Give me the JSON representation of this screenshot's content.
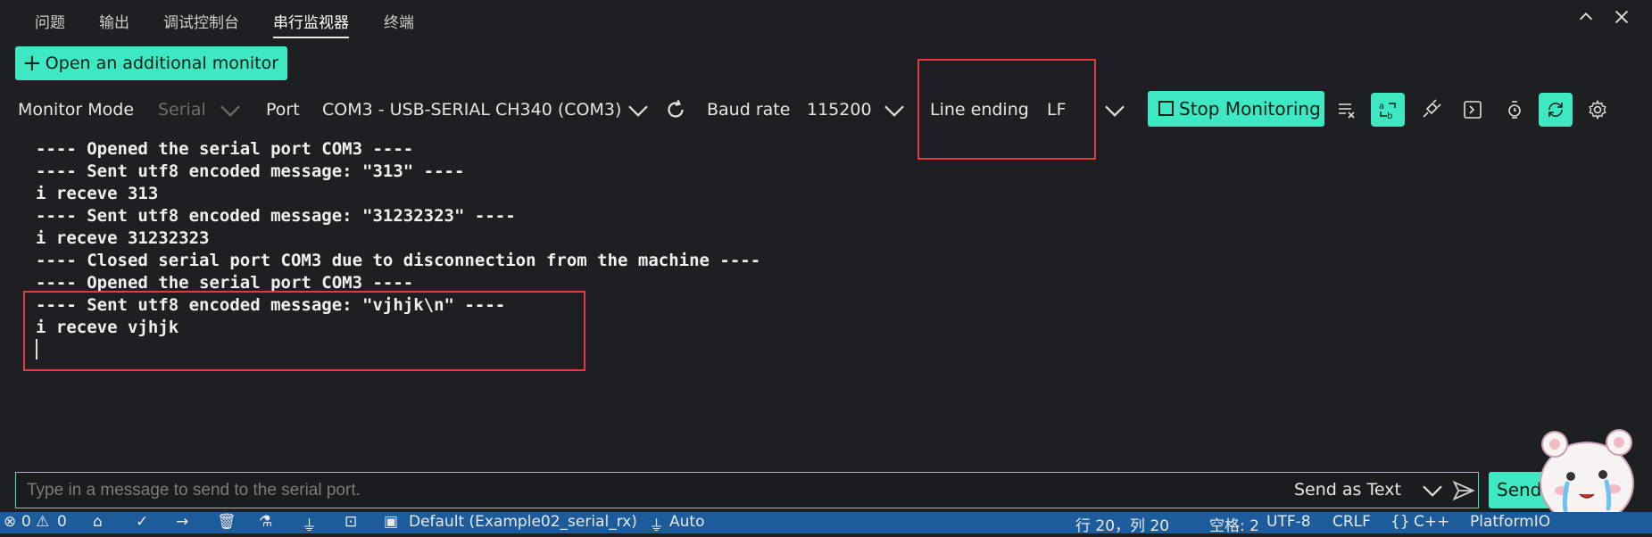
{
  "tabs": [
    {
      "label": "问题",
      "active": false
    },
    {
      "label": "输出",
      "active": false
    },
    {
      "label": "调试控制台",
      "active": false
    },
    {
      "label": "串行监视器",
      "active": true
    },
    {
      "label": "终端",
      "active": false
    }
  ],
  "window": {
    "maximize_icon": "chevron-up-icon",
    "close_icon": "close-icon"
  },
  "add_monitor": {
    "label": "Open an additional monitor"
  },
  "toolbar": {
    "monitor_mode_label": "Monitor Mode",
    "mode_value": "Serial",
    "port_label": "Port",
    "port_value": "COM3 - USB-SERIAL CH340 (COM3)",
    "baud_label": "Baud rate",
    "baud_value": "115200",
    "line_ending_label": "Line ending",
    "line_ending_value": "LF",
    "stop_label": "Stop Monitoring"
  },
  "output_lines": [
    "---- Opened the serial port COM3 ----",
    "---- Sent utf8 encoded message: \"313\" ----",
    "i receve 313",
    "---- Sent utf8 encoded message: \"31232323\" ----",
    "i receve 31232323",
    "---- Closed serial port COM3 due to disconnection from the machine ----",
    "---- Opened the serial port COM3 ----",
    "---- Sent utf8 encoded message: \"vjhjk\\n\" ----",
    "i receve vjhjk"
  ],
  "input": {
    "placeholder": "Type in a message to send to the serial port.",
    "value": "",
    "send_as": "Send as Text",
    "send_label": "Send"
  },
  "status": {
    "errors": "0",
    "warnings": "0",
    "env": "Default (Example02_serial_rx)",
    "auto": "Auto",
    "position": "行 20，列 20",
    "spaces": "空格: 2",
    "encoding": "UTF-8",
    "eol": "CRLF",
    "language": "C++",
    "platform": "PlatformIO"
  },
  "colors": {
    "accent": "#3ee8c2",
    "highlight": "#e33c3c",
    "statusbar": "#1d5c9a",
    "background": "#1e1f22"
  }
}
